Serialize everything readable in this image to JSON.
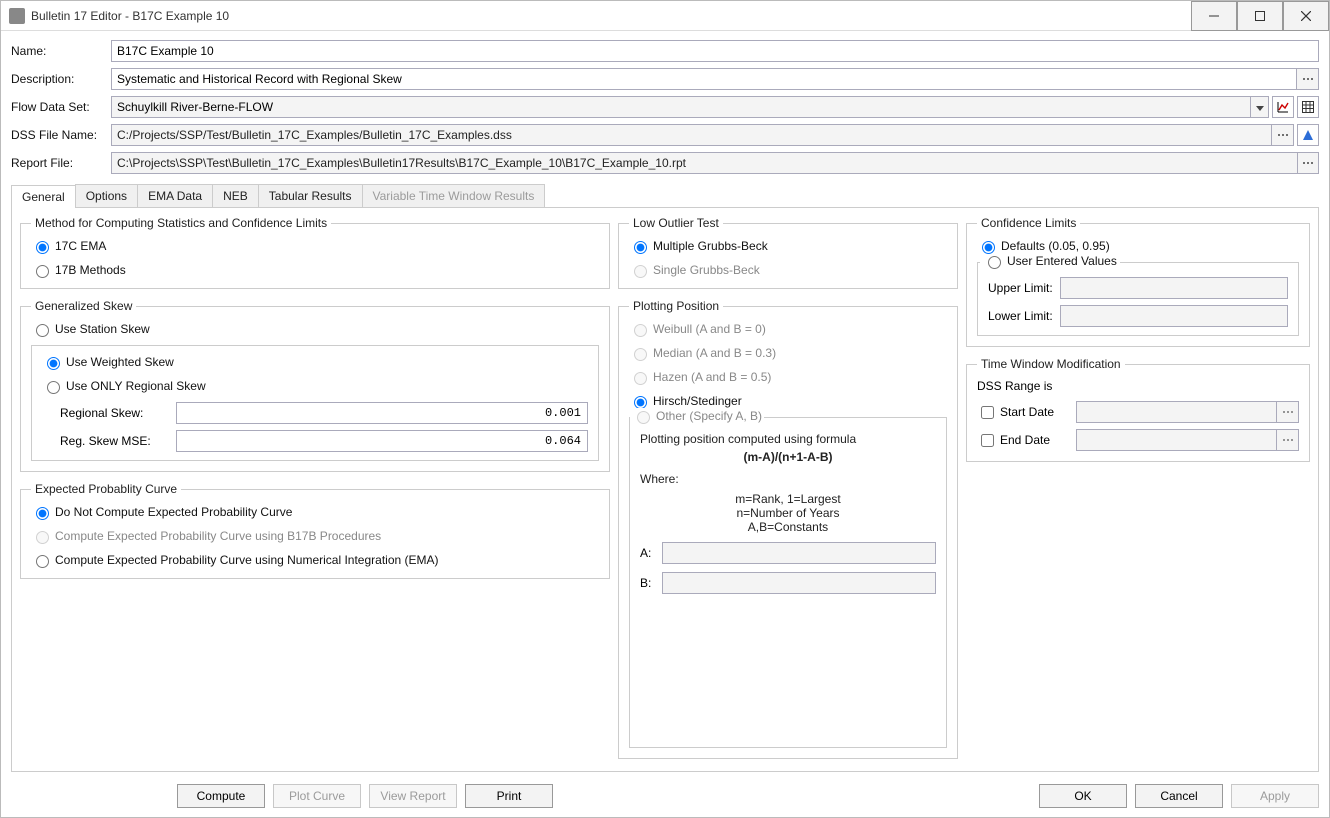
{
  "window": {
    "title": "Bulletin 17 Editor - B17C Example 10"
  },
  "labels": {
    "name": "Name:",
    "description": "Description:",
    "flowDataSet": "Flow Data Set:",
    "dssFileName": "DSS File Name:",
    "reportFile": "Report File:"
  },
  "values": {
    "name": "B17C Example 10",
    "description": "Systematic and Historical Record with Regional Skew",
    "flowDataSet": "Schuylkill River-Berne-FLOW",
    "dssFileName": "C:/Projects/SSP/Test/Bulletin_17C_Examples/Bulletin_17C_Examples.dss",
    "reportFile": "C:\\Projects\\SSP\\Test\\Bulletin_17C_Examples\\Bulletin17Results\\B17C_Example_10\\B17C_Example_10.rpt"
  },
  "tabs": {
    "general": "General",
    "options": "Options",
    "emaData": "EMA Data",
    "neb": "NEB",
    "tabularResults": "Tabular Results",
    "variableTime": "Variable Time Window Results"
  },
  "method": {
    "legend": "Method for Computing Statistics and Confidence Limits",
    "opt17cEma": "17C EMA",
    "opt17bMethods": "17B Methods"
  },
  "skew": {
    "legend": "Generalized Skew",
    "useStation": "Use Station Skew",
    "useWeighted": "Use Weighted Skew",
    "useOnlyRegional": "Use ONLY Regional Skew",
    "regionalSkewLabel": "Regional Skew:",
    "regionalSkewValue": "0.001",
    "mseLabel": "Reg. Skew MSE:",
    "mseValue": "0.064"
  },
  "expected": {
    "legend": "Expected Probablity Curve",
    "doNot": "Do Not Compute Expected Probability Curve",
    "b17b": "Compute Expected Probability Curve using B17B Procedures",
    "numeric": "Compute Expected Probability Curve using Numerical Integration (EMA)"
  },
  "lowOutlier": {
    "legend": "Low Outlier Test",
    "multiple": "Multiple Grubbs-Beck",
    "single": "Single Grubbs-Beck"
  },
  "plotting": {
    "legend": "Plotting Position",
    "weibull": "Weibull (A and B = 0)",
    "median": "Median (A and B = 0.3)",
    "hazen": "Hazen (A and B = 0.5)",
    "hirsch": "Hirsch/Stedinger",
    "other": "Other (Specify A, B)",
    "formulaLine1": "Plotting position computed using formula",
    "formulaLine2": "(m-A)/(n+1-A-B)",
    "where": "Where:",
    "leg1": "m=Rank, 1=Largest",
    "leg2": "n=Number of Years",
    "leg3": "A,B=Constants",
    "aLabel": "A:",
    "bLabel": "B:"
  },
  "confidence": {
    "legend": "Confidence Limits",
    "defaults": "Defaults (0.05, 0.95)",
    "userEntered": "User Entered Values",
    "upper": "Upper Limit:",
    "lower": "Lower Limit:"
  },
  "timeWindow": {
    "legend": "Time Window Modification",
    "dssRange": "DSS Range is",
    "startDate": "Start Date",
    "endDate": "End Date"
  },
  "buttons": {
    "compute": "Compute",
    "plotCurve": "Plot Curve",
    "viewReport": "View Report",
    "print": "Print",
    "ok": "OK",
    "cancel": "Cancel",
    "apply": "Apply"
  }
}
